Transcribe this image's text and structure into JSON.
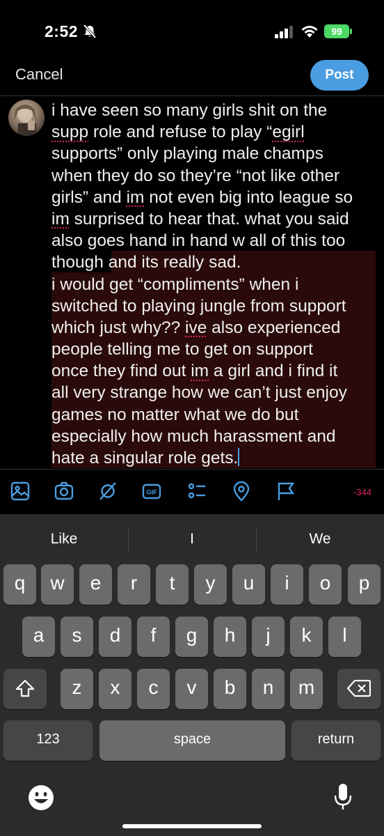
{
  "status_bar": {
    "time": "2:52",
    "battery": "99",
    "icons": [
      "mute-bell-icon",
      "signal-icon",
      "wifi-icon",
      "battery-icon"
    ],
    "battery_color": "#4cd964"
  },
  "header": {
    "cancel_label": "Cancel",
    "post_label": "Post",
    "post_color": "#4a9de0"
  },
  "tweet": {
    "lines": [
      "i have seen so many girls shit on the",
      "supp role and refuse to play “egirl",
      "supports” only playing male champs",
      "when they do so they’re “not like other",
      "girls” and im not even big into league so",
      "im surprised to hear that. what you said",
      "also goes hand in hand w all of this too",
      "though and its really sad.",
      "i would get “compliments” when i",
      "switched to playing jungle from support",
      "which just why?? ive also experienced",
      "people telling me to get on support",
      "once they find out im a girl and i find it",
      "all very strange how we can’t just enjoy",
      "games no matter what we do but",
      "especially how much harassment and",
      "hate a singular role gets."
    ],
    "spellcheck_words": [
      "supp",
      "egirl",
      "im",
      "im",
      "ive",
      "im"
    ],
    "highlight_color": "#2a0a0a"
  },
  "toolbar": {
    "icons": [
      "image-icon",
      "camera-icon",
      "grok-icon",
      "gif-icon",
      "poll-icon",
      "location-icon",
      "flag-icon"
    ],
    "gif_label": "GIF",
    "char_count": "-344",
    "icon_color": "#4a9de0",
    "count_color": "#e0245e"
  },
  "keyboard": {
    "suggestions": [
      "Like",
      "I",
      "We"
    ],
    "row1": [
      "q",
      "w",
      "e",
      "r",
      "t",
      "y",
      "u",
      "i",
      "o",
      "p"
    ],
    "row2": [
      "a",
      "s",
      "d",
      "f",
      "g",
      "h",
      "j",
      "k",
      "l"
    ],
    "row3": [
      "z",
      "x",
      "c",
      "v",
      "b",
      "n",
      "m"
    ],
    "numbers_label": "123",
    "space_label": "space",
    "return_label": "return"
  }
}
